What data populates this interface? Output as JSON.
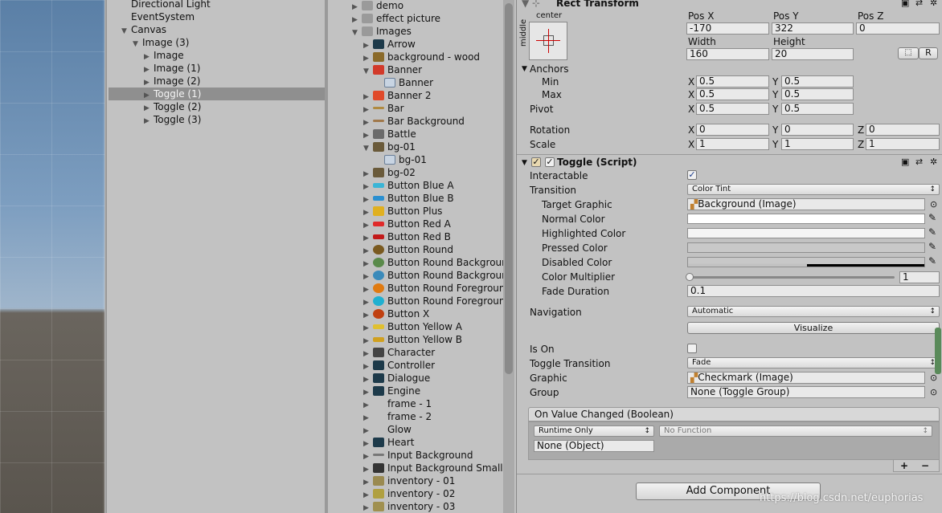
{
  "hierarchy": {
    "items": [
      {
        "label": "Directional Light",
        "indent": 0,
        "arrow": ""
      },
      {
        "label": "EventSystem",
        "indent": 0,
        "arrow": ""
      },
      {
        "label": "Canvas",
        "indent": 0,
        "arrow": "▼"
      },
      {
        "label": "Image (3)",
        "indent": 1,
        "arrow": "▼"
      },
      {
        "label": "Image",
        "indent": 2,
        "arrow": "▶"
      },
      {
        "label": "Image (1)",
        "indent": 2,
        "arrow": "▶"
      },
      {
        "label": "Image (2)",
        "indent": 2,
        "arrow": "▶"
      },
      {
        "label": "Toggle (1)",
        "indent": 2,
        "arrow": "▶",
        "selected": true
      },
      {
        "label": "Toggle (2)",
        "indent": 2,
        "arrow": "▶"
      },
      {
        "label": "Toggle (3)",
        "indent": 2,
        "arrow": "▶"
      }
    ]
  },
  "project": {
    "items": [
      {
        "label": "demo",
        "indent": 0,
        "arrow": "▶",
        "icon": "folder-icon",
        "color": "#9a9a9a"
      },
      {
        "label": "effect picture",
        "indent": 0,
        "arrow": "▶",
        "icon": "folder-icon",
        "color": "#9a9a9a"
      },
      {
        "label": "Images",
        "indent": 0,
        "arrow": "▼",
        "icon": "folder-icon",
        "color": "#9a9a9a"
      },
      {
        "label": "Arrow",
        "indent": 1,
        "arrow": "▶",
        "icon": "arrow-icon",
        "color": "#1d3a4a"
      },
      {
        "label": "background - wood",
        "indent": 1,
        "arrow": "▶",
        "icon": "wood-icon",
        "color": "#8a6a2a"
      },
      {
        "label": "Banner",
        "indent": 1,
        "arrow": "▼",
        "icon": "banner-icon",
        "color": "#d23a2a"
      },
      {
        "label": "Banner",
        "indent": 2,
        "arrow": "",
        "icon": "sprite-icon",
        "color": "#8fa7c2"
      },
      {
        "label": "Banner 2",
        "indent": 1,
        "arrow": "▶",
        "icon": "banner-icon",
        "color": "#e04a2a"
      },
      {
        "label": "Bar",
        "indent": 1,
        "arrow": "▶",
        "icon": "bar-icon",
        "color": "#b08a40"
      },
      {
        "label": "Bar Background",
        "indent": 1,
        "arrow": "▶",
        "icon": "bar-icon",
        "color": "#a0784a"
      },
      {
        "label": "Battle",
        "indent": 1,
        "arrow": "▶",
        "icon": "swords-icon",
        "color": "#6a6a6a"
      },
      {
        "label": "bg-01",
        "indent": 1,
        "arrow": "▼",
        "icon": "image-icon",
        "color": "#6a5a3a"
      },
      {
        "label": "bg-01",
        "indent": 2,
        "arrow": "",
        "icon": "sprite-icon",
        "color": "#8fa7c2"
      },
      {
        "label": "bg-02",
        "indent": 1,
        "arrow": "▶",
        "icon": "image-icon",
        "color": "#6a5a3a"
      },
      {
        "label": "Button Blue A",
        "indent": 1,
        "arrow": "▶",
        "icon": "button-icon",
        "color": "#3ab5d6"
      },
      {
        "label": "Button Blue B",
        "indent": 1,
        "arrow": "▶",
        "icon": "button-icon",
        "color": "#2a8fd0"
      },
      {
        "label": "Button Plus",
        "indent": 1,
        "arrow": "▶",
        "icon": "plus-icon",
        "color": "#e0b020"
      },
      {
        "label": "Button Red A",
        "indent": 1,
        "arrow": "▶",
        "icon": "button-icon",
        "color": "#e02a2a"
      },
      {
        "label": "Button Red B",
        "indent": 1,
        "arrow": "▶",
        "icon": "button-icon",
        "color": "#c21a1a"
      },
      {
        "label": "Button Round",
        "indent": 1,
        "arrow": "▶",
        "icon": "round-icon",
        "color": "#7a5a20"
      },
      {
        "label": "Button Round Background",
        "indent": 1,
        "arrow": "▶",
        "icon": "round-icon",
        "color": "#5a8a4a"
      },
      {
        "label": "Button Round Background",
        "indent": 1,
        "arrow": "▶",
        "icon": "round-icon",
        "color": "#3a8aba"
      },
      {
        "label": "Button Round Foreground",
        "indent": 1,
        "arrow": "▶",
        "icon": "round-icon",
        "color": "#e07a10"
      },
      {
        "label": "Button Round Foreground",
        "indent": 1,
        "arrow": "▶",
        "icon": "round-icon",
        "color": "#20b0d0"
      },
      {
        "label": "Button X",
        "indent": 1,
        "arrow": "▶",
        "icon": "x-icon",
        "color": "#c04010"
      },
      {
        "label": "Button Yellow A",
        "indent": 1,
        "arrow": "▶",
        "icon": "button-icon",
        "color": "#e0c030"
      },
      {
        "label": "Button Yellow B",
        "indent": 1,
        "arrow": "▶",
        "icon": "button-icon",
        "color": "#d0a020"
      },
      {
        "label": "Character",
        "indent": 1,
        "arrow": "▶",
        "icon": "character-icon",
        "color": "#444444"
      },
      {
        "label": "Controller",
        "indent": 1,
        "arrow": "▶",
        "icon": "controller-icon",
        "color": "#1d3a4a"
      },
      {
        "label": "Dialogue",
        "indent": 1,
        "arrow": "▶",
        "icon": "dialogue-icon",
        "color": "#1d3a4a"
      },
      {
        "label": "Engine",
        "indent": 1,
        "arrow": "▶",
        "icon": "engine-icon",
        "color": "#1d3a4a"
      },
      {
        "label": "frame - 1",
        "indent": 1,
        "arrow": "▶",
        "icon": "",
        "color": ""
      },
      {
        "label": "frame - 2",
        "indent": 1,
        "arrow": "▶",
        "icon": "",
        "color": ""
      },
      {
        "label": "Glow",
        "indent": 1,
        "arrow": "▶",
        "icon": "",
        "color": ""
      },
      {
        "label": "Heart",
        "indent": 1,
        "arrow": "▶",
        "icon": "heart-icon",
        "color": "#1d3a4a"
      },
      {
        "label": "Input Background",
        "indent": 1,
        "arrow": "▶",
        "icon": "line-icon",
        "color": "#777777"
      },
      {
        "label": "Input Background Small",
        "indent": 1,
        "arrow": "▶",
        "icon": "input-icon",
        "color": "#333333"
      },
      {
        "label": "inventory - 01",
        "indent": 1,
        "arrow": "▶",
        "icon": "inventory-icon",
        "color": "#9a8a50"
      },
      {
        "label": "inventory - 02",
        "indent": 1,
        "arrow": "▶",
        "icon": "inventory-icon",
        "color": "#b0a040"
      },
      {
        "label": "inventory - 03",
        "indent": 1,
        "arrow": "▶",
        "icon": "inventory-icon",
        "color": "#a09050"
      }
    ]
  },
  "rect": {
    "title": "Rect Transform",
    "anchor_h": "center",
    "anchor_v": "middle",
    "pos_x_label": "Pos X",
    "pos_y_label": "Pos Y",
    "pos_z_label": "Pos Z",
    "pos_x": "-170",
    "pos_y": "322",
    "pos_z": "0",
    "width_label": "Width",
    "height_label": "Height",
    "width": "160",
    "height": "20",
    "r_label": "R",
    "anchors_label": "Anchors",
    "min_label": "Min",
    "max_label": "Max",
    "min_x": "0.5",
    "min_y": "0.5",
    "max_x": "0.5",
    "max_y": "0.5",
    "pivot_label": "Pivot",
    "pivot_x": "0.5",
    "pivot_y": "0.5",
    "rotation_label": "Rotation",
    "rot_x": "0",
    "rot_y": "0",
    "rot_z": "0",
    "scale_label": "Scale",
    "scale_x": "1",
    "scale_y": "1",
    "scale_z": "1",
    "x": "X",
    "y": "Y",
    "z": "Z"
  },
  "toggle": {
    "title": "Toggle (Script)",
    "interactable_label": "Interactable",
    "transition_label": "Transition",
    "transition_value": "Color Tint",
    "target_graphic_label": "Target Graphic",
    "target_graphic_value": "Background (Image)",
    "normal_color_label": "Normal Color",
    "highlighted_color_label": "Highlighted Color",
    "pressed_color_label": "Pressed Color",
    "disabled_color_label": "Disabled Color",
    "color_multiplier_label": "Color Multiplier",
    "color_multiplier_value": "1",
    "fade_duration_label": "Fade Duration",
    "fade_duration_value": "0.1",
    "navigation_label": "Navigation",
    "navigation_value": "Automatic",
    "visualize_label": "Visualize",
    "is_on_label": "Is On",
    "toggle_transition_label": "Toggle Transition",
    "toggle_transition_value": "Fade",
    "graphic_label": "Graphic",
    "graphic_value": "Checkmark (Image)",
    "group_label": "Group",
    "group_value": "None (Toggle Group)",
    "event_label": "On Value Changed (Boolean)",
    "runtime_value": "Runtime Only",
    "function_value": "No Function",
    "object_value": "None (Object)",
    "plus": "+",
    "minus": "−"
  },
  "add_component_label": "Add Component",
  "watermark": "https://blog.csdn.net/euphorias"
}
